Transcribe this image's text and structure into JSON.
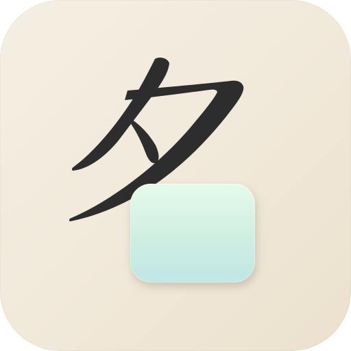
{
  "app_icon": {
    "glyph": "夕",
    "colors": {
      "background_top_left": "#f5efe3",
      "background_bottom_right": "#ebe1cd",
      "glyph": "#2d2d2d",
      "card_top": "#e4fbe9",
      "card_bottom": "#bfe7e6"
    }
  }
}
